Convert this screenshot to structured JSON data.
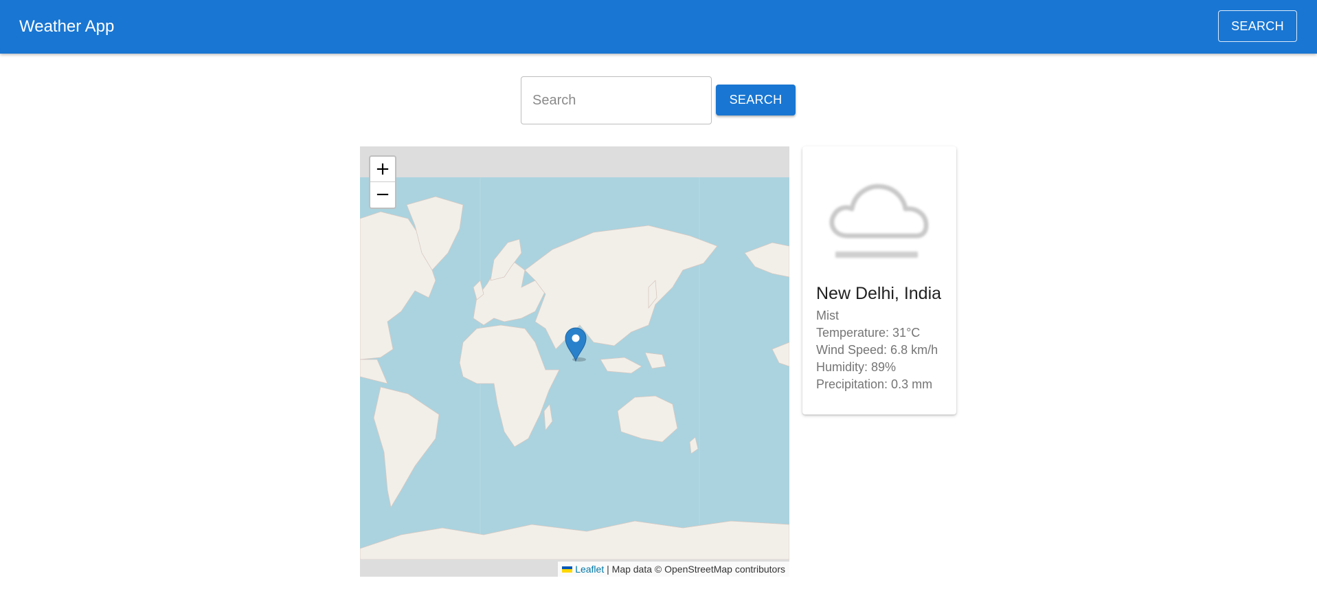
{
  "header": {
    "title": "Weather App",
    "search_button": "SEARCH"
  },
  "search": {
    "placeholder": "Search",
    "value": "",
    "button": "SEARCH"
  },
  "map": {
    "zoom_in": "+",
    "zoom_out": "−",
    "attribution": {
      "link": "Leaflet",
      "text": " | Map data © OpenStreetMap contributors"
    },
    "marker_icon": "map-pin-icon"
  },
  "weather": {
    "icon": "mist-cloud-icon",
    "city": "New Delhi, India",
    "condition": "Mist",
    "temperature": "Temperature: 31°C",
    "wind_speed": "Wind Speed: 6.8 km/h",
    "humidity": "Humidity: 89%",
    "precipitation": "Precipitation: 0.3 mm"
  },
  "colors": {
    "primary": "#1976d2",
    "ocean": "#aad3df",
    "land": "#f2efe9",
    "marker": "#2a81cb"
  }
}
